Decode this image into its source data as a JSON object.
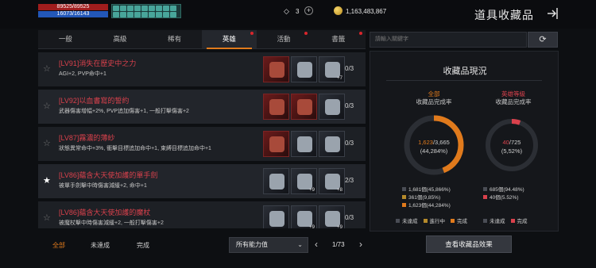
{
  "status": {
    "hp": "89525/89525",
    "mp": "16073/16143"
  },
  "currency": {
    "gem_count": "3",
    "gem_plus": "+",
    "gold": "1,163,483,867"
  },
  "page": {
    "title": "道具收藏品"
  },
  "tabs": [
    {
      "label": "一般",
      "active": false,
      "dot": false
    },
    {
      "label": "高級",
      "active": false,
      "dot": false
    },
    {
      "label": "稀有",
      "active": false,
      "dot": false
    },
    {
      "label": "英雄",
      "active": true,
      "dot": true
    },
    {
      "label": "活動",
      "active": false,
      "dot": true
    },
    {
      "label": "書籤",
      "active": false,
      "dot": true
    }
  ],
  "list": [
    {
      "title": "[LV91]消失在歷史中之力",
      "desc": "AGI+2, PVP命中+1",
      "count": "0/3",
      "starred": false,
      "items": [
        {
          "type": "red",
          "badge": ""
        },
        {
          "type": "dark",
          "badge": ""
        },
        {
          "type": "dark",
          "badge": "+7"
        }
      ]
    },
    {
      "title": "[LV92]以血書寫的誓約",
      "desc": "武器傷害增幅+2%, PVP追加傷害+1, 一般打擊傷害+2",
      "count": "0/3",
      "starred": false,
      "items": [
        {
          "type": "red",
          "badge": ""
        },
        {
          "type": "red",
          "badge": ""
        },
        {
          "type": "dark",
          "badge": ""
        }
      ]
    },
    {
      "title": "[LV87]霧濃的薄紗",
      "desc": "狀態異常命中+3%, 衝擊目標追加命中+1, 束縛目標追加命中+1",
      "count": "0/3",
      "starred": false,
      "items": [
        {
          "type": "red",
          "badge": ""
        },
        {
          "type": "dark",
          "badge": ""
        },
        {
          "type": "dark",
          "badge": ""
        }
      ]
    },
    {
      "title": "[LV86]蘊含大天使加護的單手劍",
      "desc": "被單手劍擊中時傷害減緩+2, 命中+1",
      "count": "2/3",
      "starred": true,
      "items": [
        {
          "type": "dark",
          "badge": ""
        },
        {
          "type": "dark",
          "badge": "+9"
        },
        {
          "type": "dark",
          "badge": "+8"
        }
      ]
    },
    {
      "title": "[LV86]蘊含大天使加護的魔杖",
      "desc": "被魔杖擊中時傷害減緩+2, 一般打擊傷害+2",
      "count": "0/3",
      "starred": false,
      "items": [
        {
          "type": "dark",
          "badge": ""
        },
        {
          "type": "dark",
          "badge": "+9"
        },
        {
          "type": "dark",
          "badge": "+9"
        }
      ]
    }
  ],
  "filters": {
    "all": "全部",
    "incomplete": "未達成",
    "complete": "完成"
  },
  "ability_select": {
    "value": "所有能力值"
  },
  "pager": {
    "text": "1/73"
  },
  "search": {
    "placeholder": "請輸入關鍵字"
  },
  "panel": {
    "title": "收藏品現況",
    "all": {
      "label1": "全部",
      "label2": "收藏品完成率",
      "value": "1,623",
      "total": "/3,665",
      "percent": "(44,284%)",
      "progress": 0.4428,
      "color": "#e07a1c",
      "legend": [
        {
          "text": "1,681個(45,866%)",
          "color": "#4a4d55"
        },
        {
          "text": "361個(9,85%)",
          "color": "#b58a2b"
        },
        {
          "text": "1,623個(44,284%)",
          "color": "#e07a1c"
        }
      ]
    },
    "hero": {
      "label1": "英雄等級",
      "label2": "收藏品完成率",
      "value": "40",
      "total": "/725",
      "percent": "(5,52%)",
      "progress": 0.0552,
      "color": "#d9414c",
      "legend": [
        {
          "text": "685個(94.48%)",
          "color": "#4a4d55"
        },
        {
          "text": "40個(5.52%)",
          "color": "#d9414c"
        }
      ]
    },
    "key_all": [
      "未達成",
      "進行中",
      "完成"
    ],
    "key_hero": [
      "未達成",
      "完成"
    ]
  },
  "view_button": {
    "label": "查看收藏品效果"
  },
  "colors": {
    "accent": "#e07a1c",
    "hero_red": "#d9414c"
  }
}
